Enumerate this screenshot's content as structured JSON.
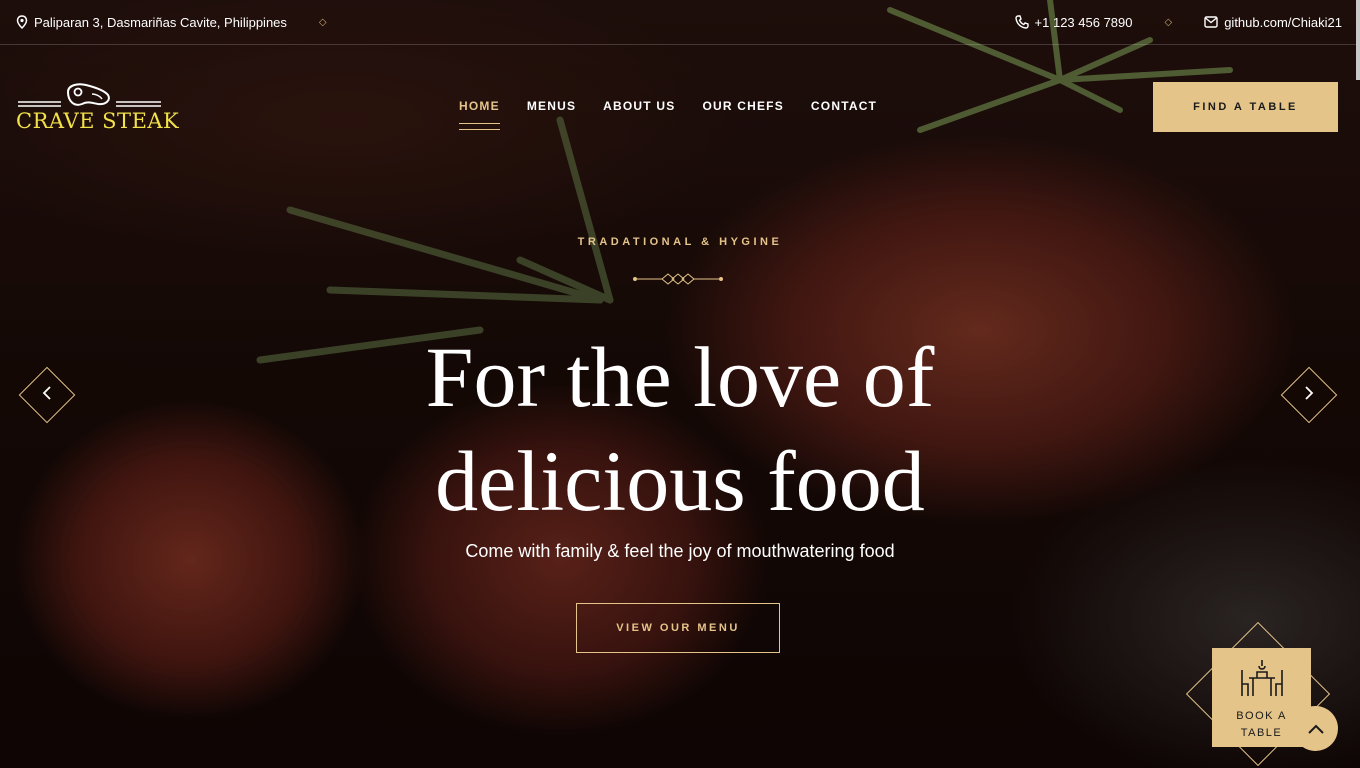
{
  "topbar": {
    "address": "Paliparan 3, Dasmariñas Cavite, Philippines",
    "phone": "+1 123 456 7890",
    "github": "github.com/Chiaki21"
  },
  "logo": {
    "text": "CRAVE STEAK"
  },
  "nav": {
    "items": [
      {
        "label": "HOME",
        "active": true
      },
      {
        "label": "MENUS",
        "active": false
      },
      {
        "label": "ABOUT US",
        "active": false
      },
      {
        "label": "OUR CHEFS",
        "active": false
      },
      {
        "label": "CONTACT",
        "active": false
      }
    ],
    "cta": "FIND A TABLE"
  },
  "hero": {
    "subtitle": "TRADATIONAL & HYGINE",
    "headline_line1": "For the love of",
    "headline_line2": "delicious food",
    "tagline": "Come with family & feel the joy of mouthwatering food",
    "button": "VIEW OUR MENU"
  },
  "book_widget": {
    "label": "BOOK A TABLE"
  },
  "icons": {
    "location": "location-pin-icon",
    "phone": "phone-icon",
    "mail": "mail-icon",
    "prev": "chevron-left-icon",
    "next": "chevron-right-icon",
    "top": "chevron-up-icon",
    "table": "dining-table-icon"
  },
  "colors": {
    "accent": "#e5c48a",
    "logo": "#f2e24a"
  }
}
